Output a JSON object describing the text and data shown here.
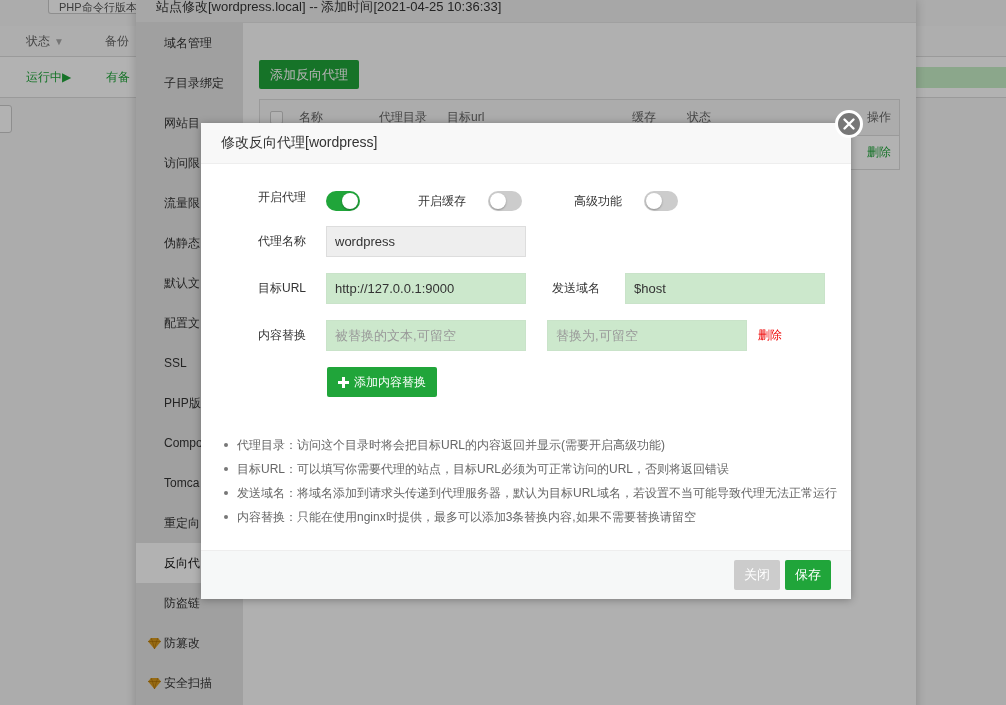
{
  "background_page": {
    "toolbar_button": "PHP命令行版本",
    "columns": [
      {
        "label": "状态",
        "sort_mark": "▼"
      },
      {
        "label": "备份"
      }
    ],
    "row": {
      "status": "运行中▶",
      "backup": "有备"
    }
  },
  "site_window": {
    "title": "站点修改[wordpress.local] -- 添加时间[2021-04-25 10:36:33]",
    "sidebar": {
      "items": [
        {
          "label": "域名管理",
          "selected": false,
          "kind": "plain"
        },
        {
          "label": "子目录绑定",
          "selected": false,
          "kind": "plain"
        },
        {
          "label": "网站目",
          "selected": false,
          "kind": "plain"
        },
        {
          "label": "访问限",
          "selected": false,
          "kind": "plain"
        },
        {
          "label": "流量限",
          "selected": false,
          "kind": "plain"
        },
        {
          "label": "伪静态",
          "selected": false,
          "kind": "plain"
        },
        {
          "label": "默认文",
          "selected": false,
          "kind": "plain"
        },
        {
          "label": "配置文",
          "selected": false,
          "kind": "plain"
        },
        {
          "label": "SSL",
          "selected": false,
          "kind": "plain"
        },
        {
          "label": "PHP版",
          "selected": false,
          "kind": "plain"
        },
        {
          "label": "Compo",
          "selected": false,
          "kind": "plain"
        },
        {
          "label": "Tomca",
          "selected": false,
          "kind": "plain"
        },
        {
          "label": "重定向",
          "selected": false,
          "kind": "plain"
        },
        {
          "label": "反向代",
          "selected": true,
          "kind": "plain"
        },
        {
          "label": "防盗链",
          "selected": false,
          "kind": "plain"
        },
        {
          "label": "防篡改",
          "selected": false,
          "kind": "premium"
        },
        {
          "label": "安全扫描",
          "selected": false,
          "kind": "premium"
        }
      ]
    },
    "add_button": "添加反向代理",
    "table": {
      "header_checked": false,
      "columns": [
        "名称",
        "代理目录",
        "目标url",
        "缓存",
        "状态",
        "操作"
      ],
      "rows": [
        {
          "action": "删除"
        }
      ]
    }
  },
  "dialog": {
    "title": "修改反向代理[wordpress]",
    "toggles": [
      {
        "label": "开启代理",
        "on": true
      },
      {
        "label": "开启缓存",
        "on": false
      },
      {
        "label": "高级功能",
        "on": false
      }
    ],
    "rows": [
      {
        "items": [
          {
            "kind": "label",
            "text": "代理名称"
          },
          {
            "kind": "field",
            "value": "wordpress",
            "readonly": true
          }
        ]
      },
      {
        "items": [
          {
            "kind": "label",
            "text": "目标URL"
          },
          {
            "kind": "field",
            "value": "http://127.0.0.1:9000",
            "readonly": false
          },
          {
            "kind": "label",
            "text": "发送域名"
          },
          {
            "kind": "field",
            "value": "$host",
            "readonly": false
          }
        ]
      },
      {
        "items": [
          {
            "kind": "label",
            "text": "内容替换"
          },
          {
            "kind": "field",
            "placeholder": "被替换的文本,可留空",
            "readonly": false
          },
          {
            "kind": "field",
            "placeholder": "替换为,可留空",
            "readonly": false
          },
          {
            "kind": "link",
            "text": "删除"
          }
        ]
      }
    ],
    "add_replace_button": "添加内容替换",
    "notes": [
      "代理目录：访问这个目录时将会把目标URL的内容返回并显示(需要开启高级功能)",
      "目标URL：可以填写你需要代理的站点，目标URL必须为可正常访问的URL，否则将返回错误",
      "发送域名：将域名添加到请求头传递到代理服务器，默认为目标URL域名，若设置不当可能导致代理无法正常运行",
      "内容替换：只能在使用nginx时提供，最多可以添加3条替换内容,如果不需要替换请留空"
    ],
    "buttons": [
      {
        "label": "关闭",
        "kind": "secondary"
      },
      {
        "label": "保存",
        "kind": "primary"
      }
    ]
  }
}
